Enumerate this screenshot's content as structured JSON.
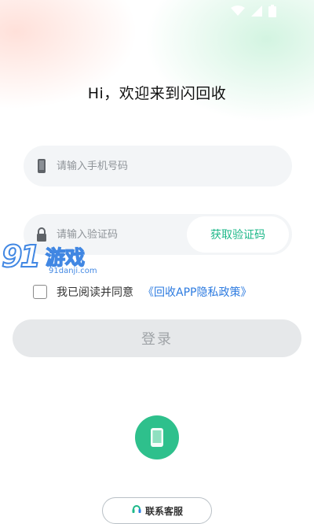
{
  "colors": {
    "accent_green": "#1db889",
    "link_blue": "#2d7be0",
    "button_disabled_bg": "#e6e8ea",
    "button_disabled_text": "#9fa3a7",
    "field_bg": "#f3f5f7",
    "phone_button_bg": "#2ec08c"
  },
  "status_bar": {
    "icons": [
      "wifi-icon",
      "signal-icon",
      "battery-icon"
    ]
  },
  "header": {
    "title": "Hi，欢迎来到闪回收"
  },
  "form": {
    "phone": {
      "placeholder": "请输入手机号码",
      "value": "",
      "icon": "phone-icon"
    },
    "code": {
      "placeholder": "请输入验证码",
      "value": "",
      "icon": "lock-icon",
      "get_code_label": "获取验证码"
    }
  },
  "watermark": {
    "number": "91",
    "text": "游戏",
    "url": "91danji.com"
  },
  "agreement": {
    "checked": false,
    "text": "我已阅读并同意",
    "policy_link": "《回收APP隐私政策》"
  },
  "login_button": {
    "label": "登录",
    "enabled": false
  },
  "alt_login": {
    "icon": "phone-icon"
  },
  "contact_button": {
    "label": "联系客服",
    "icon": "customer-service-icon"
  }
}
